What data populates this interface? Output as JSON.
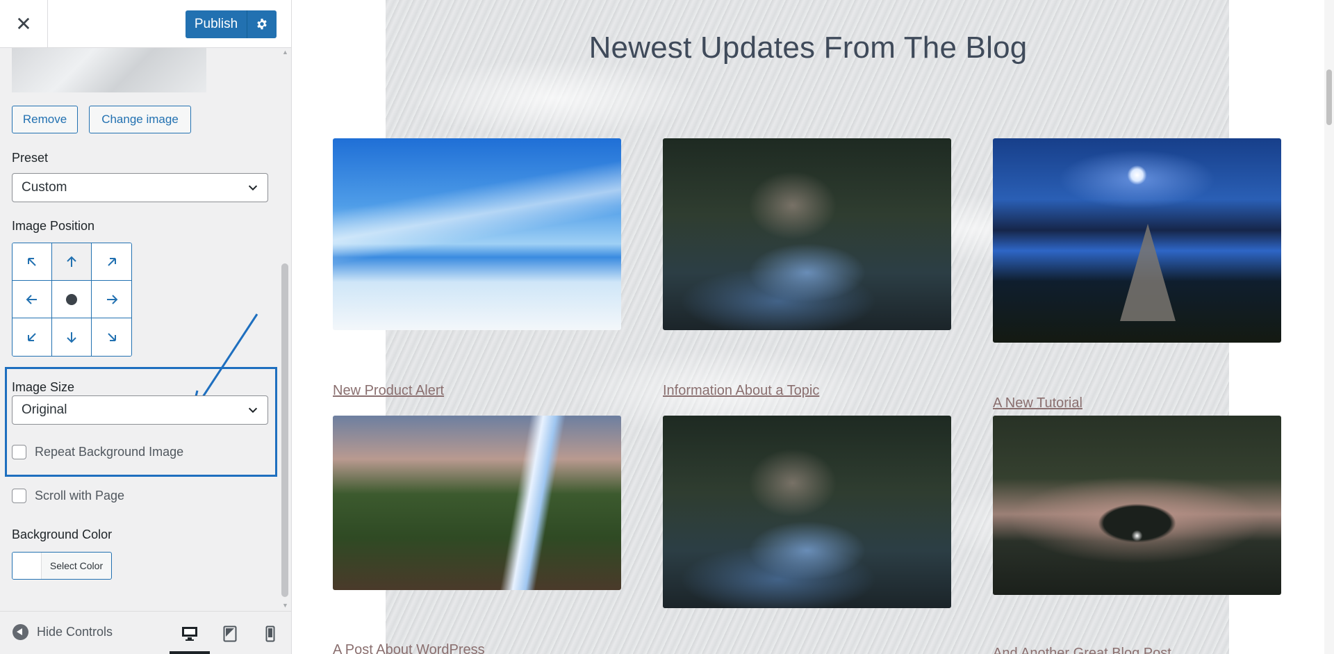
{
  "header": {
    "close_label": "✕",
    "publish_label": "Publish"
  },
  "background_image": {
    "remove_label": "Remove",
    "change_label": "Change image"
  },
  "preset": {
    "label": "Preset",
    "value": "Custom"
  },
  "image_position": {
    "label": "Image Position",
    "selected": "center"
  },
  "image_size": {
    "label": "Image Size",
    "value": "Original"
  },
  "repeat": {
    "label": "Repeat Background Image",
    "checked": false
  },
  "scroll": {
    "label": "Scroll with Page",
    "checked": false
  },
  "background_color": {
    "label": "Background Color",
    "select_label": "Select Color"
  },
  "footer": {
    "hide_controls_label": "Hide Controls",
    "devices": [
      "desktop",
      "tablet",
      "mobile"
    ],
    "active_device": "desktop"
  },
  "preview": {
    "title": "Newest Updates From The Blog",
    "posts": [
      {
        "title": "New Product Alert",
        "image": "sky-beach"
      },
      {
        "title": "Information About a Topic",
        "image": "forest-stream"
      },
      {
        "title": "A New Tutorial",
        "image": "lake-dock-moon"
      },
      {
        "title": "A Post About WordPress",
        "image": "waterfall"
      },
      {
        "title": "",
        "image": "forest-stream"
      },
      {
        "title": "And Another Great Blog Post",
        "image": "tree-sunset"
      }
    ]
  },
  "colors": {
    "accent": "#2271b1",
    "highlight": "#1e6fbf",
    "link": "#8a6f6f"
  }
}
